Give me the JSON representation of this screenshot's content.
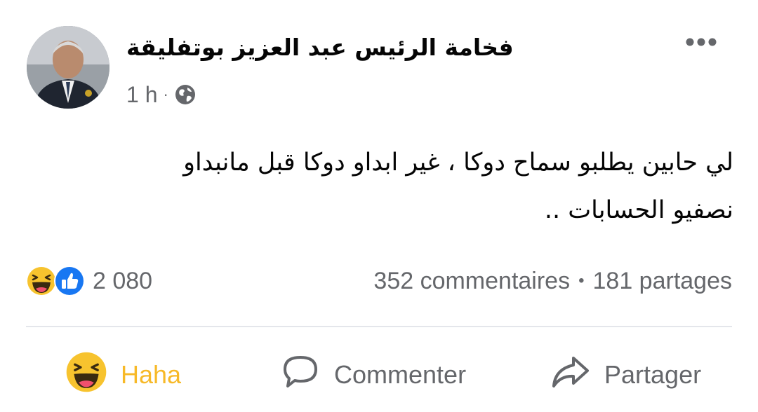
{
  "post": {
    "page_name": "فخامة الرئيس عبد العزيز بوتفليقة",
    "time": "1 h",
    "meta_separator": "·",
    "privacy_icon": "globe-icon",
    "more_icon": "more-options-icon",
    "text_lines": [
      "لي حابين يطلبو سماح دوكا ، غير ابداو دوكا قبل مانبداو",
      "نصفيو الحسابات .."
    ]
  },
  "stats": {
    "reaction_icons": [
      "haha-reaction-icon",
      "like-reaction-icon"
    ],
    "reaction_count": "2 080",
    "comments": "352 commentaires",
    "separator": "•",
    "shares": "181 partages"
  },
  "actions": {
    "haha_label": "Haha",
    "comment_label": "Commenter",
    "share_label": "Partager"
  },
  "colors": {
    "haha": "#f7b928",
    "like": "#1877f2",
    "secondary_text": "#65676b",
    "divider": "#e4e6eb"
  }
}
